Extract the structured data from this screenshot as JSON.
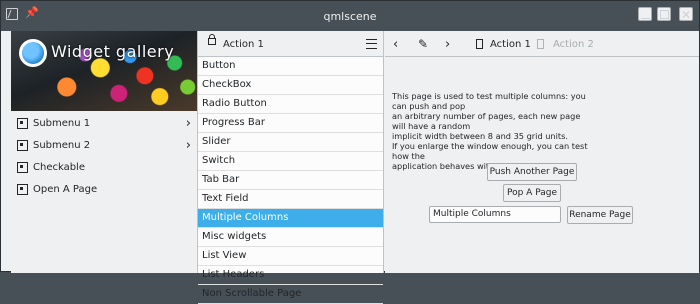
{
  "window": {
    "title": "qmlscene"
  },
  "banner": {
    "title": "Widget gallery"
  },
  "global_menu": {
    "items": [
      {
        "label": "Submenu 1",
        "icon": "submenu-icon",
        "chevron": "›"
      },
      {
        "label": "Submenu 2",
        "icon": "submenu-icon",
        "chevron": "›"
      },
      {
        "label": "Checkable",
        "icon": "checkable-icon"
      },
      {
        "label": "Open A Page",
        "icon": "page-icon"
      }
    ]
  },
  "list_page": {
    "toolbar": {
      "action_label": "Action 1"
    },
    "items": [
      "Button",
      "CheckBox",
      "Radio Button",
      "Progress Bar",
      "Slider",
      "Switch",
      "Tab Bar",
      "Text Field",
      "Multiple Columns",
      "Misc widgets",
      "List View",
      "List Headers",
      "Non Scrollable Page"
    ],
    "selected_index": 8
  },
  "detail_page": {
    "toolbar": {
      "back": "‹",
      "forward": "›",
      "pencil": "✎",
      "action1_label": "Action 1",
      "action2_label": "Action 2"
    },
    "description": "This page is used to test multiple columns: you can push and pop\nan arbitrary number of pages, each new page will have a random\nimplicit width between 8 and 35 grid units.\nIf you enlarge the window enough, you can test how the\napplication behaves with multiple columns.",
    "push_label": "Push Another Page",
    "pop_label": "Pop A Page",
    "field_value": "Multiple Columns",
    "rename_label": "Rename Page"
  },
  "colors": {
    "titlebar": "#475057",
    "selection": "#3daee9",
    "background": "#eff0f1"
  }
}
